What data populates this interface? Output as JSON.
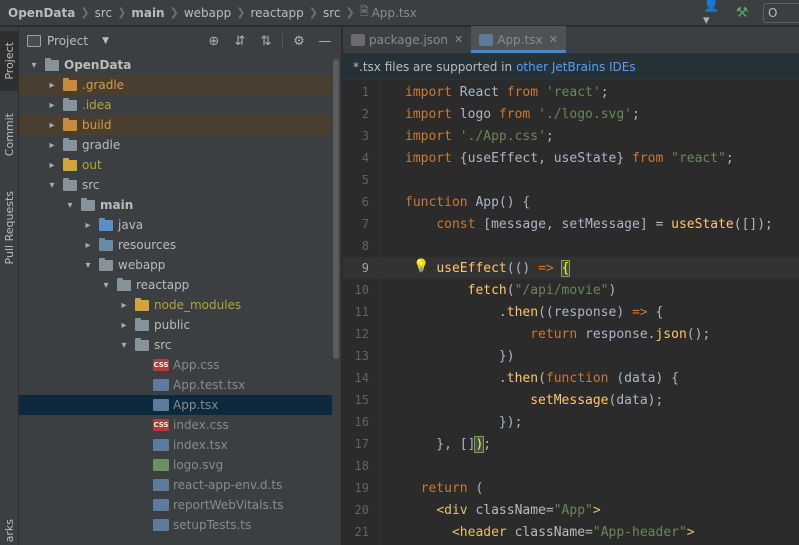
{
  "breadcrumbs": [
    {
      "label": "OpenData",
      "bold": true
    },
    {
      "label": "src",
      "bold": false
    },
    {
      "label": "main",
      "bold": true
    },
    {
      "label": "webapp",
      "bold": false
    },
    {
      "label": "reactapp",
      "bold": false
    },
    {
      "label": "src",
      "bold": false
    },
    {
      "label": "App.tsx",
      "bold": false
    }
  ],
  "toolbar": {
    "user_icon": "user-icon",
    "build_icon": "hammer-icon",
    "run_config_label": "O"
  },
  "tool_stripe": {
    "project_label": "Project",
    "commit_label": "Commit",
    "pull_requests_label": "Pull Requests",
    "bookmarks_label": "arks"
  },
  "project_panel": {
    "title": "Project",
    "tools": [
      "locate-icon",
      "expand-all-icon",
      "collapse-all-icon",
      "gear-icon",
      "hide-icon"
    ]
  },
  "tree": [
    {
      "label": "OpenData",
      "depth": 0,
      "arrow": "▾",
      "icon": "folder",
      "color": "blue",
      "style": "bold",
      "excluded": false
    },
    {
      "label": ".gradle",
      "depth": 1,
      "arrow": "▸",
      "icon": "folder",
      "color": "orange",
      "style": "orange",
      "excluded": true
    },
    {
      "label": ".idea",
      "depth": 1,
      "arrow": "▸",
      "icon": "folder",
      "color": "gray",
      "style": "olive",
      "excluded": false
    },
    {
      "label": "build",
      "depth": 1,
      "arrow": "▸",
      "icon": "folder",
      "color": "orange",
      "style": "orange",
      "excluded": true
    },
    {
      "label": "gradle",
      "depth": 1,
      "arrow": "▸",
      "icon": "folder",
      "color": "gray",
      "style": "normal",
      "excluded": false
    },
    {
      "label": "out",
      "depth": 1,
      "arrow": "▸",
      "icon": "folder",
      "color": "yellow",
      "style": "olive",
      "excluded": false
    },
    {
      "label": "src",
      "depth": 1,
      "arrow": "▾",
      "icon": "folder",
      "color": "gray",
      "style": "normal",
      "excluded": false
    },
    {
      "label": "main",
      "depth": 2,
      "arrow": "▾",
      "icon": "folder",
      "color": "gray",
      "style": "bold",
      "excluded": false
    },
    {
      "label": "java",
      "depth": 3,
      "arrow": "▸",
      "icon": "folder",
      "color": "src-blue",
      "style": "normal",
      "excluded": false
    },
    {
      "label": "resources",
      "depth": 3,
      "arrow": "▸",
      "icon": "folder",
      "color": "teal",
      "style": "normal",
      "excluded": false
    },
    {
      "label": "webapp",
      "depth": 3,
      "arrow": "▾",
      "icon": "folder",
      "color": "gray",
      "style": "normal",
      "excluded": false
    },
    {
      "label": "reactapp",
      "depth": 4,
      "arrow": "▾",
      "icon": "folder",
      "color": "gray",
      "style": "normal",
      "excluded": false
    },
    {
      "label": "node_modules",
      "depth": 5,
      "arrow": "▸",
      "icon": "folder",
      "color": "yellow",
      "style": "olive",
      "excluded": false
    },
    {
      "label": "public",
      "depth": 5,
      "arrow": "▸",
      "icon": "folder",
      "color": "gray",
      "style": "normal",
      "excluded": false
    },
    {
      "label": "src",
      "depth": 5,
      "arrow": "▾",
      "icon": "folder",
      "color": "gray",
      "style": "normal",
      "excluded": false
    },
    {
      "label": "App.css",
      "depth": 6,
      "arrow": "",
      "icon": "css",
      "style": "gray",
      "excluded": false
    },
    {
      "label": "App.test.tsx",
      "depth": 6,
      "arrow": "",
      "icon": "tsx",
      "style": "gray",
      "excluded": false
    },
    {
      "label": "App.tsx",
      "depth": 6,
      "arrow": "",
      "icon": "tsx",
      "style": "gray",
      "excluded": false,
      "selected": true
    },
    {
      "label": "index.css",
      "depth": 6,
      "arrow": "",
      "icon": "css",
      "style": "gray",
      "excluded": false
    },
    {
      "label": "index.tsx",
      "depth": 6,
      "arrow": "",
      "icon": "tsx",
      "style": "gray",
      "excluded": false
    },
    {
      "label": "logo.svg",
      "depth": 6,
      "arrow": "",
      "icon": "svg",
      "style": "gray",
      "excluded": false
    },
    {
      "label": "react-app-env.d.ts",
      "depth": 6,
      "arrow": "",
      "icon": "ts",
      "style": "gray",
      "excluded": false
    },
    {
      "label": "reportWebVitals.ts",
      "depth": 6,
      "arrow": "",
      "icon": "ts",
      "style": "gray",
      "excluded": false
    },
    {
      "label": "setupTests.ts",
      "depth": 6,
      "arrow": "",
      "icon": "ts",
      "style": "gray",
      "excluded": false
    }
  ],
  "editor_tabs": [
    {
      "label": "package.json",
      "icon": "json",
      "active": false
    },
    {
      "label": "App.tsx",
      "icon": "tsx",
      "active": true
    }
  ],
  "banner": {
    "text": "*.tsx files are supported in",
    "link": "other JetBrains IDEs"
  },
  "code_lines": [
    {
      "n": "1",
      "tokens": [
        [
          "kw",
          "import"
        ],
        [
          "pl",
          " React "
        ],
        [
          "kw",
          "from"
        ],
        [
          "pl",
          " "
        ],
        [
          "st",
          "'react'"
        ],
        [
          "pl",
          ";"
        ]
      ]
    },
    {
      "n": "2",
      "tokens": [
        [
          "kw",
          "import"
        ],
        [
          "pl",
          " logo "
        ],
        [
          "kw",
          "from"
        ],
        [
          "pl",
          " "
        ],
        [
          "st",
          "'./logo.svg'"
        ],
        [
          "pl",
          ";"
        ]
      ]
    },
    {
      "n": "3",
      "tokens": [
        [
          "kw",
          "import"
        ],
        [
          "pl",
          " "
        ],
        [
          "st",
          "'./App.css'"
        ],
        [
          "pl",
          ";"
        ]
      ]
    },
    {
      "n": "4",
      "tokens": [
        [
          "kw",
          "import"
        ],
        [
          "pl",
          " {useEffect, useState} "
        ],
        [
          "kw",
          "from"
        ],
        [
          "pl",
          " "
        ],
        [
          "st",
          "\"react\""
        ],
        [
          "pl",
          ";"
        ]
      ]
    },
    {
      "n": "5",
      "tokens": []
    },
    {
      "n": "6",
      "tokens": [
        [
          "kw",
          "function"
        ],
        [
          "pl",
          " App() {"
        ]
      ]
    },
    {
      "n": "7",
      "tokens": [
        [
          "pl",
          "    "
        ],
        [
          "kw",
          "const"
        ],
        [
          "pl",
          " [message, setMessage] = "
        ],
        [
          "fn",
          "useState"
        ],
        [
          "pl",
          "([]);"
        ]
      ]
    },
    {
      "n": "8",
      "tokens": []
    },
    {
      "n": "9",
      "tokens": [
        [
          "pl",
          "    "
        ],
        [
          "fn",
          "useEffect"
        ],
        [
          "pl",
          "(() "
        ],
        [
          "kw",
          "=>"
        ],
        [
          "pl",
          " "
        ],
        [
          "brk",
          "{"
        ]
      ],
      "current": true,
      "bulb": true
    },
    {
      "n": "10",
      "tokens": [
        [
          "pl",
          "        "
        ],
        [
          "fn",
          "fetch"
        ],
        [
          "pl",
          "("
        ],
        [
          "st",
          "\"/api/movie\""
        ],
        [
          "pl",
          ")"
        ]
      ]
    },
    {
      "n": "11",
      "tokens": [
        [
          "pl",
          "            ."
        ],
        [
          "fn",
          "then"
        ],
        [
          "pl",
          "((response) "
        ],
        [
          "kw",
          "=>"
        ],
        [
          "pl",
          " {"
        ]
      ]
    },
    {
      "n": "12",
      "tokens": [
        [
          "pl",
          "                "
        ],
        [
          "kw",
          "return"
        ],
        [
          "pl",
          " response."
        ],
        [
          "fn",
          "json"
        ],
        [
          "pl",
          "();"
        ]
      ]
    },
    {
      "n": "13",
      "tokens": [
        [
          "pl",
          "            })"
        ]
      ]
    },
    {
      "n": "14",
      "tokens": [
        [
          "pl",
          "            ."
        ],
        [
          "fn",
          "then"
        ],
        [
          "pl",
          "("
        ],
        [
          "kw",
          "function"
        ],
        [
          "pl",
          " (data) {"
        ]
      ]
    },
    {
      "n": "15",
      "tokens": [
        [
          "pl",
          "                "
        ],
        [
          "fn",
          "setMessage"
        ],
        [
          "pl",
          "(data);"
        ]
      ]
    },
    {
      "n": "16",
      "tokens": [
        [
          "pl",
          "            });"
        ]
      ]
    },
    {
      "n": "17",
      "tokens": [
        [
          "pl",
          "    }, []"
        ],
        [
          "brk",
          ")"
        ],
        [
          "pl",
          ";"
        ]
      ]
    },
    {
      "n": "18",
      "tokens": []
    },
    {
      "n": "19",
      "tokens": [
        [
          "pl",
          "  "
        ],
        [
          "kw",
          "return"
        ],
        [
          "pl",
          " ("
        ]
      ]
    },
    {
      "n": "20",
      "tokens": [
        [
          "pl",
          "    "
        ],
        [
          "tg",
          "<div"
        ],
        [
          "pl",
          " "
        ],
        [
          "at",
          "className"
        ],
        [
          "pl",
          "="
        ],
        [
          "st",
          "\"App\""
        ],
        [
          "tg",
          ">"
        ]
      ]
    },
    {
      "n": "21",
      "tokens": [
        [
          "pl",
          "      "
        ],
        [
          "tg",
          "<header"
        ],
        [
          "pl",
          " "
        ],
        [
          "at",
          "className"
        ],
        [
          "pl",
          "="
        ],
        [
          "st",
          "\"App-header\""
        ],
        [
          "tg",
          ">"
        ]
      ]
    }
  ]
}
